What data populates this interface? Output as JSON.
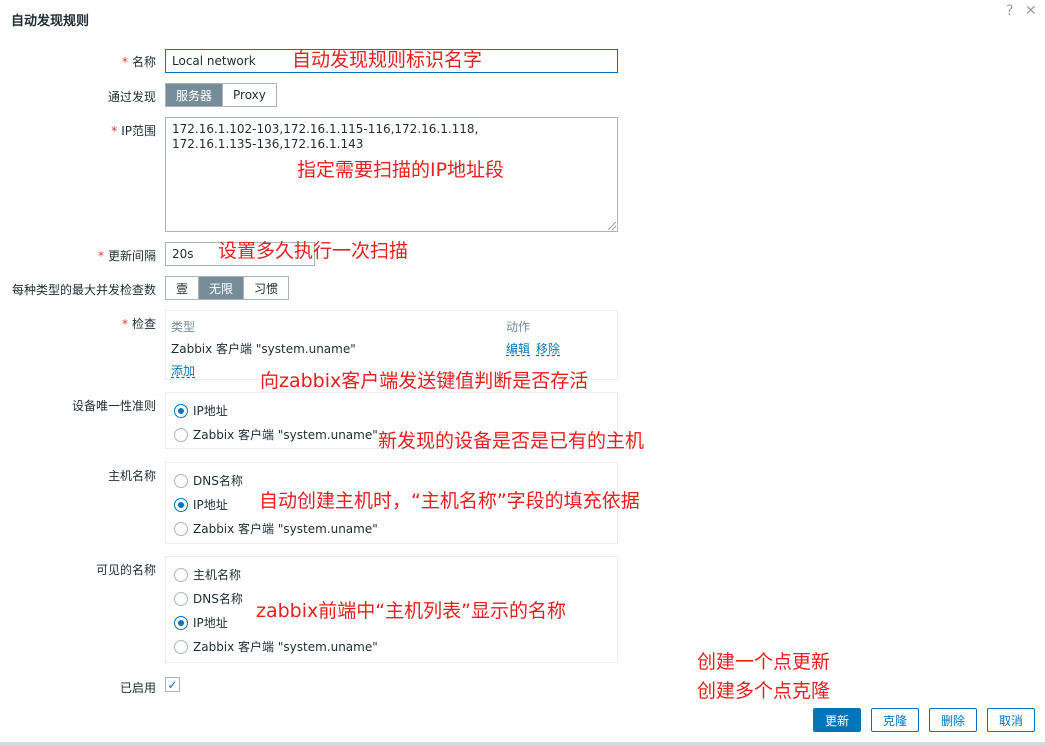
{
  "dialog": {
    "title": "自动发现规则",
    "help_icon": "?",
    "close_icon": "✕"
  },
  "fields": {
    "name": {
      "label": "名称",
      "value": "Local network"
    },
    "discovery_by": {
      "label": "通过发现",
      "options": [
        "服务器",
        "Proxy"
      ],
      "selected": "服务器"
    },
    "ip_range": {
      "label": "IP范围",
      "value": "172.16.1.102-103,172.16.1.115-116,172.16.1.118,\n172.16.1.135-136,172.16.1.143"
    },
    "update_interval": {
      "label": "更新间隔",
      "value": "20s"
    },
    "max_concurrent": {
      "label": "每种类型的最大并发检查数",
      "options": [
        "壹",
        "无限",
        "习惯"
      ],
      "selected": "无限"
    },
    "checks": {
      "label": "检查",
      "col_type": "类型",
      "col_action": "动作",
      "rows": [
        {
          "type": "Zabbix 客户端 \"system.uname\"",
          "edit": "编辑",
          "remove": "移除"
        }
      ],
      "add": "添加"
    },
    "uniqueness": {
      "label": "设备唯一性准则",
      "options": [
        "IP地址",
        "Zabbix 客户端 \"system.uname\""
      ],
      "selected": "IP地址"
    },
    "host_name": {
      "label": "主机名称",
      "options": [
        "DNS名称",
        "IP地址",
        "Zabbix 客户端 \"system.uname\""
      ],
      "selected": "IP地址"
    },
    "visible_name": {
      "label": "可见的名称",
      "options": [
        "主机名称",
        "DNS名称",
        "IP地址",
        "Zabbix 客户端 \"system.uname\""
      ],
      "selected": "IP地址"
    },
    "enabled": {
      "label": "已启用",
      "checked": true
    }
  },
  "buttons": {
    "update": "更新",
    "clone": "克隆",
    "delete": "删除",
    "cancel": "取消"
  },
  "annotations": {
    "name": "自动发现规则标识名字",
    "ip_range": "指定需要扫描的IP地址段",
    "interval": "设置多久执行一次扫描",
    "checks": "向zabbix客户端发送键值判断是否存活",
    "uniqueness": "新发现的设备是否是已有的主机",
    "host_name": "自动创建主机时，“主机名称”字段的填充依据",
    "visible_name": "zabbix前端中“主机列表”显示的名称",
    "buttons_line1": "创建一个点更新",
    "buttons_line2": "创建多个点克隆"
  },
  "colors": {
    "accent": "#0275b8",
    "segment_active": "#768d99",
    "annotation": "#e81f1f",
    "required": "#e33734"
  }
}
